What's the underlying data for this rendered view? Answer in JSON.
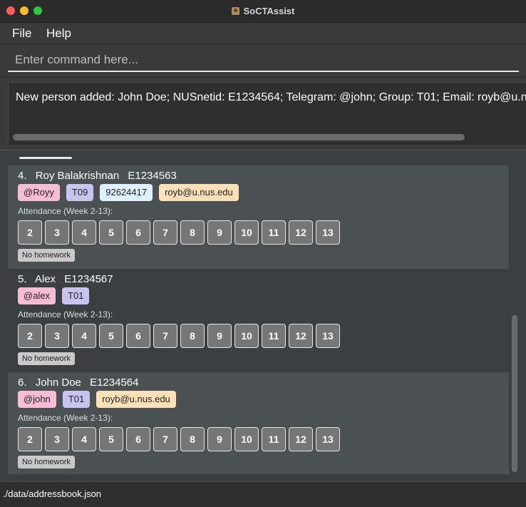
{
  "window": {
    "title": "SoCTAssist"
  },
  "menu": {
    "file": "File",
    "help": "Help"
  },
  "command": {
    "placeholder": "Enter command here...",
    "value": ""
  },
  "result": {
    "text": "New person added: John Doe; NUSnetid: E1234564; Telegram: @john; Group: T01; Email: royb@u.nus.edu"
  },
  "attendance_label": "Attendance (Week 2-13):",
  "weeks": [
    "2",
    "3",
    "4",
    "5",
    "6",
    "7",
    "8",
    "9",
    "10",
    "11",
    "12",
    "13"
  ],
  "persons": [
    {
      "index": "4.",
      "name": "Roy Balakrishnan",
      "nusnetid": "E1234563",
      "telegram": "@Royy",
      "group": "T09",
      "phone": "92624417",
      "email": "royb@u.nus.edu",
      "homework": "No homework"
    },
    {
      "index": "5.",
      "name": "Alex",
      "nusnetid": "E1234567",
      "telegram": "@alex",
      "group": "T01",
      "phone": "",
      "email": "",
      "homework": "No homework"
    },
    {
      "index": "6.",
      "name": "John Doe",
      "nusnetid": "E1234564",
      "telegram": "@john",
      "group": "T01",
      "phone": "",
      "email": "royb@u.nus.edu",
      "homework": "No homework"
    }
  ],
  "status": {
    "path": "./data/addressbook.json"
  },
  "colors": {
    "telegram_tag": "#f8bcd3",
    "group_tag": "#c9c3ef",
    "phone_tag": "#dff0ff",
    "email_tag": "#fde0b8",
    "card_light": "#4b5153",
    "card_dark": "#3c3f41"
  }
}
